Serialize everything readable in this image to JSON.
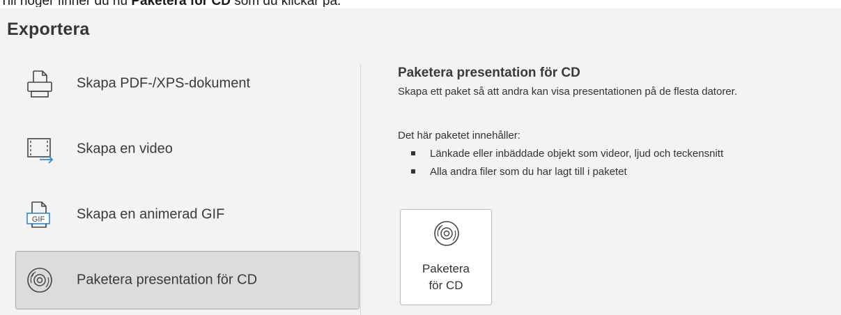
{
  "caption": {
    "before": "Till höger finner du nu ",
    "bold": "Paketera för CD",
    "after": " som du klickar på."
  },
  "section_title": "Exportera",
  "export_items": [
    {
      "label": "Skapa PDF-/XPS-dokument",
      "icon": "document-printer-icon"
    },
    {
      "label": "Skapa en video",
      "icon": "video-export-icon"
    },
    {
      "label": "Skapa en animerad GIF",
      "icon": "gif-icon",
      "icon_text": "GIF"
    },
    {
      "label": "Paketera presentation för CD",
      "icon": "cd-icon",
      "selected": true
    }
  ],
  "detail": {
    "title": "Paketera presentation för CD",
    "description": "Skapa ett paket så att andra kan visa presentationen på de flesta datorer.",
    "contains_heading": "Det här paketet innehåller:",
    "bullets": [
      "Länkade eller inbäddade objekt som videor, ljud och teckensnitt",
      "Alla andra filer som du har lagt till i paketet"
    ],
    "button": {
      "line1": "Paketera",
      "line2": "för CD",
      "icon": "cd-icon"
    }
  },
  "colors": {
    "panel_background": "#f3f3f3",
    "selected_background": "#dcdcdc",
    "accent_blue": "#2f8ad8"
  }
}
